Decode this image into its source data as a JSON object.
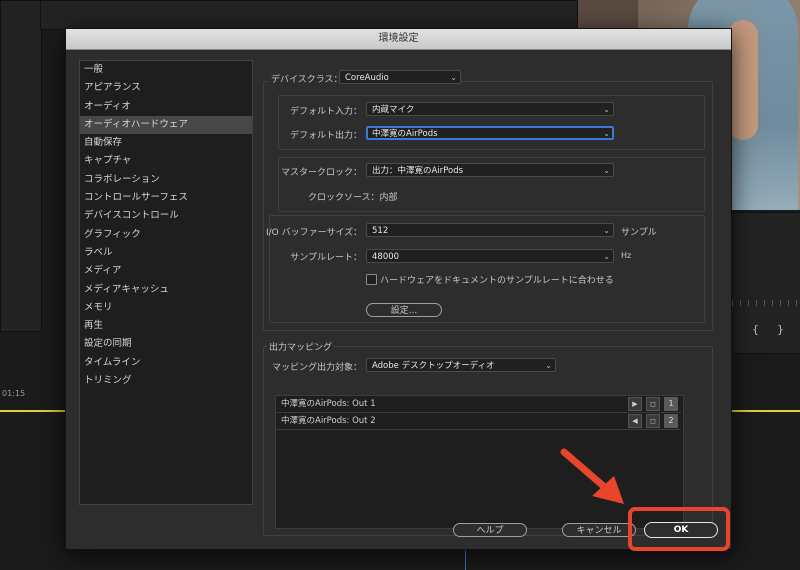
{
  "dialog": {
    "title": "環境設定"
  },
  "sidebar": {
    "items": [
      {
        "label": "一般"
      },
      {
        "label": "アピアランス"
      },
      {
        "label": "オーディオ"
      },
      {
        "label": "オーディオハードウェア",
        "selected": true
      },
      {
        "label": "自動保存"
      },
      {
        "label": "キャプチャ"
      },
      {
        "label": "コラボレーション"
      },
      {
        "label": "コントロールサーフェス"
      },
      {
        "label": "デバイスコントロール"
      },
      {
        "label": "グラフィック"
      },
      {
        "label": "ラベル"
      },
      {
        "label": "メディア"
      },
      {
        "label": "メディアキャッシュ"
      },
      {
        "label": "メモリ"
      },
      {
        "label": "再生"
      },
      {
        "label": "設定の同期"
      },
      {
        "label": "タイムライン"
      },
      {
        "label": "トリミング"
      }
    ]
  },
  "device": {
    "class_label": "デバイスクラス：",
    "class_value": "CoreAudio",
    "default_input_label": "デフォルト入力：",
    "default_input_value": "内蔵マイク",
    "default_output_label": "デフォルト出力：",
    "default_output_value": "中澤寛のAirPods",
    "master_clock_label": "マスタークロック：",
    "master_clock_value": "出力：中澤寛のAirPods",
    "clock_source_label": "クロックソース：内部",
    "buffer_label": "I/O バッファーサイズ：",
    "buffer_value": "512",
    "buffer_unit": "サンプル",
    "sample_rate_label": "サンプルレート：",
    "sample_rate_value": "48000",
    "sample_rate_unit": "Hz",
    "match_checkbox_label": "ハードウェアをドキュメントのサンプルレートに合わせる",
    "match_checkbox_checked": false,
    "settings_button": "設定..."
  },
  "output_mapping": {
    "group_label": "出力マッピング",
    "target_label": "マッピング出力対象：",
    "target_value": "Adobe デスクトップオーディオ",
    "rows": [
      {
        "name": "中澤寛のAirPods: Out 1",
        "channel": "1"
      },
      {
        "name": "中澤寛のAirPods: Out 2",
        "channel": "2"
      }
    ]
  },
  "buttons": {
    "help": "ヘルプ",
    "cancel": "キャンセル",
    "ok": "OK"
  },
  "background": {
    "timecode": "01:15",
    "brace_left": "{",
    "brace_right": "}"
  },
  "colors": {
    "annotation": "#e8452c",
    "focus": "#3a7bd5",
    "timeline": "#d9d23a"
  },
  "chevron": "⌄"
}
